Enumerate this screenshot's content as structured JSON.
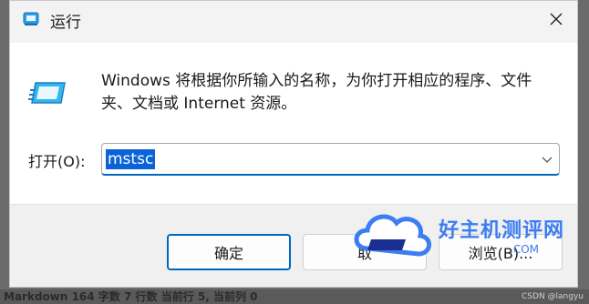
{
  "window": {
    "title": "运行",
    "description": "Windows 将根据你所输入的名称，为你打开相应的程序、文件夹、文档或 Internet 资源。",
    "open_label": "打开(O):",
    "input_value": "mstsc"
  },
  "buttons": {
    "ok": "确定",
    "cancel": "取",
    "browse": "浏览(B)..."
  },
  "watermark": {
    "brand": "好主机测评网",
    "domain": ".COM"
  },
  "taskbar": {
    "left_text": "Markdown  164 字数  7 行数  当前行 5, 当前列 0",
    "right_text": "CSDN @langyu"
  },
  "colors": {
    "accent": "#0067c0",
    "selection": "#0a64d8",
    "watermark": "#3d7df2"
  },
  "icons": [
    "run-title-icon",
    "close-icon",
    "run-app-icon",
    "chevron-down-icon",
    "cloud-logo-icon"
  ]
}
